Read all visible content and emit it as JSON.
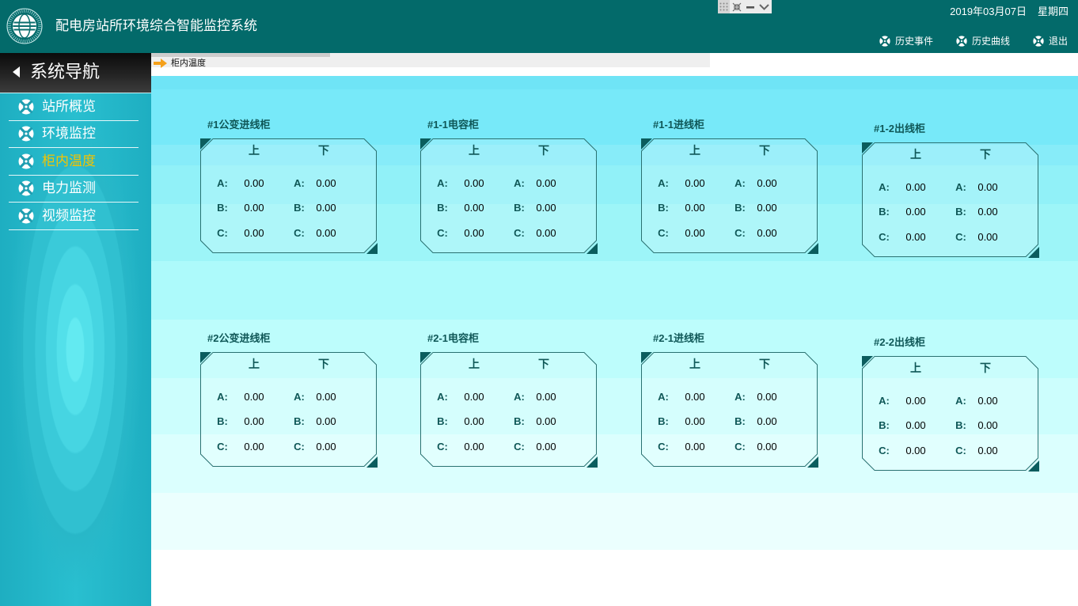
{
  "header": {
    "title": "配电房站所环境综合智能监控系统",
    "logo_icon": "state-grid-logo",
    "date": "2019年03月07日",
    "weekday": "星期四",
    "actions": [
      {
        "label": "历史事件",
        "icon": "ring-icon"
      },
      {
        "label": "历史曲线",
        "icon": "ring-icon"
      },
      {
        "label": "退出",
        "icon": "ring-icon"
      }
    ]
  },
  "window_controls": {
    "icons": [
      "grid-icon",
      "collapse-icon",
      "minimize-icon",
      "chevron-down-icon"
    ]
  },
  "sidebar": {
    "title": "系统导航",
    "back_icon": "caret-left-icon",
    "items": [
      {
        "label": "站所概览",
        "icon": "ring-icon",
        "active": false
      },
      {
        "label": "环境监控",
        "icon": "ring-icon",
        "active": false
      },
      {
        "label": "柜内温度",
        "icon": "ring-icon",
        "active": true
      },
      {
        "label": "电力监测",
        "icon": "ring-icon",
        "active": false
      },
      {
        "label": "视频监控",
        "icon": "ring-icon",
        "active": false
      }
    ]
  },
  "breadcrumb": {
    "icon": "arrow-right-icon",
    "current": "柜内温度"
  },
  "cabinet_labels": {
    "upper": "上",
    "lower": "下"
  },
  "cabinets": [
    {
      "name": "#1公变进线柜",
      "rows": [
        {
          "phase": "A:",
          "upper": "0.00",
          "lower": "0.00"
        },
        {
          "phase": "B:",
          "upper": "0.00",
          "lower": "0.00"
        },
        {
          "phase": "C:",
          "upper": "0.00",
          "lower": "0.00"
        }
      ]
    },
    {
      "name": "#1-1电容柜",
      "rows": [
        {
          "phase": "A:",
          "upper": "0.00",
          "lower": "0.00"
        },
        {
          "phase": "B:",
          "upper": "0.00",
          "lower": "0.00"
        },
        {
          "phase": "C:",
          "upper": "0.00",
          "lower": "0.00"
        }
      ]
    },
    {
      "name": "#1-1进线柜",
      "rows": [
        {
          "phase": "A:",
          "upper": "0.00",
          "lower": "0.00"
        },
        {
          "phase": "B:",
          "upper": "0.00",
          "lower": "0.00"
        },
        {
          "phase": "C:",
          "upper": "0.00",
          "lower": "0.00"
        }
      ]
    },
    {
      "name": "#1-2出线柜",
      "rows": [
        {
          "phase": "A:",
          "upper": "0.00",
          "lower": "0.00"
        },
        {
          "phase": "B:",
          "upper": "0.00",
          "lower": "0.00"
        },
        {
          "phase": "C:",
          "upper": "0.00",
          "lower": "0.00"
        }
      ]
    },
    {
      "name": "#2公变进线柜",
      "rows": [
        {
          "phase": "A:",
          "upper": "0.00",
          "lower": "0.00"
        },
        {
          "phase": "B:",
          "upper": "0.00",
          "lower": "0.00"
        },
        {
          "phase": "C:",
          "upper": "0.00",
          "lower": "0.00"
        }
      ]
    },
    {
      "name": "#2-1电容柜",
      "rows": [
        {
          "phase": "A:",
          "upper": "0.00",
          "lower": "0.00"
        },
        {
          "phase": "B:",
          "upper": "0.00",
          "lower": "0.00"
        },
        {
          "phase": "C:",
          "upper": "0.00",
          "lower": "0.00"
        }
      ]
    },
    {
      "name": "#2-1进线柜",
      "rows": [
        {
          "phase": "A:",
          "upper": "0.00",
          "lower": "0.00"
        },
        {
          "phase": "B:",
          "upper": "0.00",
          "lower": "0.00"
        },
        {
          "phase": "C:",
          "upper": "0.00",
          "lower": "0.00"
        }
      ]
    },
    {
      "name": "#2-2出线柜",
      "rows": [
        {
          "phase": "A:",
          "upper": "0.00",
          "lower": "0.00"
        },
        {
          "phase": "B:",
          "upper": "0.00",
          "lower": "0.00"
        },
        {
          "phase": "C:",
          "upper": "0.00",
          "lower": "0.00"
        }
      ]
    }
  ],
  "colors": {
    "header_bg": "#036a6a",
    "nav_active": "#f4c400",
    "sidebar_icon": "#1d9db0",
    "breadcrumb_arrow": "#f5a01a",
    "cabinet_text": "#0f5757",
    "cabinet_border": "#2a7171",
    "cabinet_corner": "#0b5d5e"
  }
}
